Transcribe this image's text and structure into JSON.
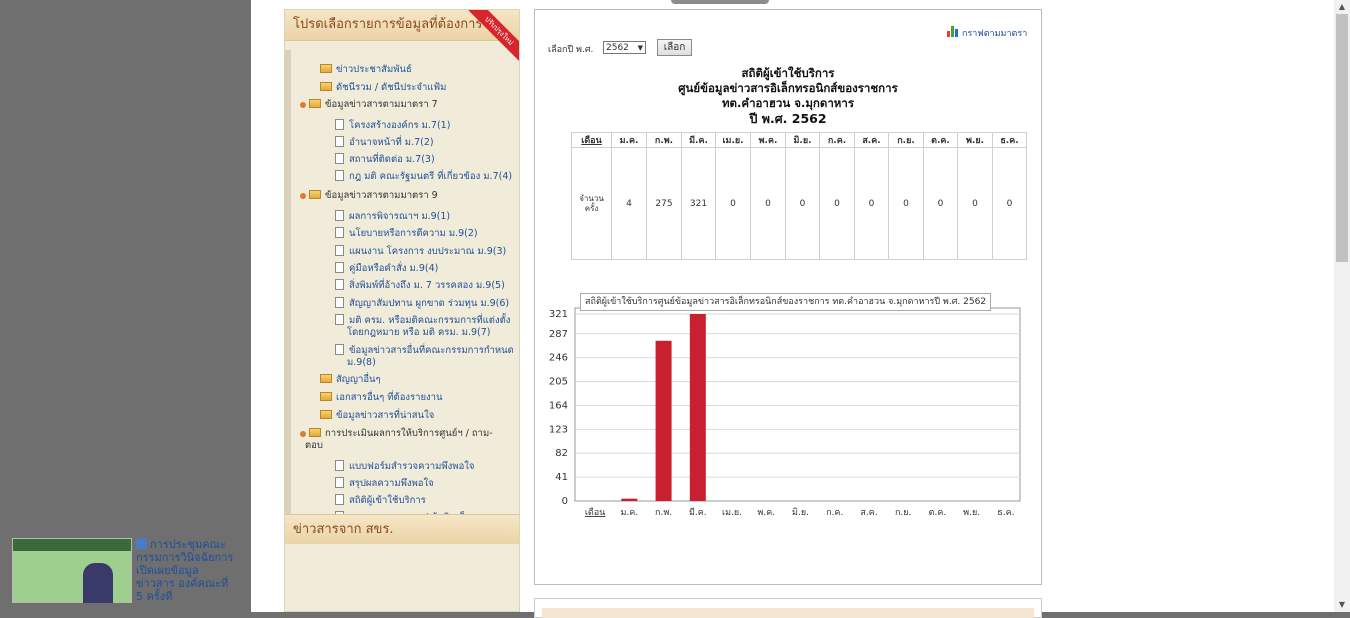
{
  "sidebar": {
    "header": "โปรดเลือกรายการข้อมูลที่ต้องการ",
    "ribbon": "ปรับปรุงใหม่",
    "items": [
      {
        "type": "folder",
        "label": "ข่าวประชาสัมพันธ์"
      },
      {
        "type": "folder",
        "label": "ดัชนีรวม / ดัชนีประจำแฟ้ม"
      },
      {
        "type": "group",
        "label": "ข้อมูลข่าวสารตามมาตรา 7"
      },
      {
        "type": "page",
        "label": "โครงสร้างองค์กร ม.7(1)"
      },
      {
        "type": "page",
        "label": "อำนาจหน้าที่ ม.7(2)"
      },
      {
        "type": "page",
        "label": "สถานที่ติดต่อ ม.7(3)"
      },
      {
        "type": "page",
        "label": "กฎ มติ คณะรัฐมนตรี ที่เกี่ยวข้อง ม.7(4)"
      },
      {
        "type": "group",
        "label": "ข้อมูลข่าวสารตามมาตรา 9"
      },
      {
        "type": "page",
        "label": "ผลการพิจารณาฯ ม.9(1)"
      },
      {
        "type": "page",
        "label": "นโยบายหรือการตีความ ม.9(2)"
      },
      {
        "type": "page",
        "label": "แผนงาน โครงการ งบประมาณ ม.9(3)"
      },
      {
        "type": "page",
        "label": "คู่มือหรือคำสั่ง ม.9(4)"
      },
      {
        "type": "page",
        "label": "สิ่งพิมพ์ที่อ้างถึง ม. 7 วรรคสอง ม.9(5)"
      },
      {
        "type": "page",
        "label": "สัญญาสัมปทาน ผูกขาด ร่วมทุน ม.9(6)"
      },
      {
        "type": "page",
        "label": "มติ ครม. หรือมติคณะกรรมการที่แต่งตั้ง",
        "label2": "โดยกฎหมาย หรือ มติ ครม. ม.9(7)"
      },
      {
        "type": "page",
        "label": "ข้อมูลข่าวสารอื่นที่คณะกรรมการกำหนด",
        "label2": "ม.9(8)"
      },
      {
        "type": "folder",
        "label": "สัญญาอื่นๆ"
      },
      {
        "type": "folder",
        "label": "เอกสารอื่นๆ ที่ต้องรายงาน"
      },
      {
        "type": "folder",
        "label": "ข้อมูลข่าวสารที่น่าสนใจ"
      },
      {
        "type": "group",
        "label": "การประเมินผลการให้บริการศูนย์ฯ / ถาม-",
        "label2": "ตอบ"
      },
      {
        "type": "page",
        "label": "แบบฟอร์มสำรวจความพึงพอใจ"
      },
      {
        "type": "page",
        "label": "สรุปผลความพึงพอใจ"
      },
      {
        "type": "page",
        "label": "สถิติผู้เข้าใช้บริการ"
      },
      {
        "type": "page",
        "label": "กระดานถาม-ตอบ / ข้อคิดเห็น"
      }
    ],
    "news_header": "ข่าวสารจาก สขร.",
    "news_text": "การประชุมคณะกรรมการวินิจฉัยการเปิดเผยข้อมูลข่าวสาร องค์คณะที่ 5 ครั้งที่"
  },
  "main": {
    "graph_link": "กราฟตามมาตรา",
    "year_label": "เลือกปี พ.ศ.",
    "year_value": "2562",
    "select_button": "เลือก",
    "title_line1": "สถิติผู้เข้าใช้บริการ",
    "title_line2": "ศูนย์ข้อมูลข่าวสารอิเล็กทรอนิกส์ของราชการ",
    "title_line3": "ทต.คำอาฮวน จ.มุกดาหาร",
    "title_line4": "ปี พ.ศ. 2562",
    "table": {
      "month_header": "เดือน",
      "months": [
        "ม.ค.",
        "ก.พ.",
        "มี.ค.",
        "เม.ย.",
        "พ.ค.",
        "มิ.ย.",
        "ก.ค.",
        "ส.ค.",
        "ก.ย.",
        "ต.ค.",
        "พ.ย.",
        "ธ.ค."
      ],
      "row_label_1": "จำนวน",
      "row_label_2": "ครั้ง",
      "values": [
        "4",
        "275",
        "321",
        "0",
        "0",
        "0",
        "0",
        "0",
        "0",
        "0",
        "0",
        "0"
      ]
    }
  },
  "chart_data": {
    "type": "bar",
    "title": "สถิติผู้เข้าใช้บริการศูนย์ข้อมูลข่าวสารอิเล็กทรอนิกส์ของราชการ ทต.คำอาฮวน จ.มุกดาหารปี พ.ศ. 2562",
    "x_header": "เดือน",
    "categories": [
      "ม.ค.",
      "ก.พ.",
      "มี.ค.",
      "เม.ย.",
      "พ.ค.",
      "มิ.ย.",
      "ก.ค.",
      "ส.ค.",
      "ก.ย.",
      "ต.ค.",
      "พ.ย.",
      "ธ.ค."
    ],
    "values": [
      4,
      275,
      321,
      0,
      0,
      0,
      0,
      0,
      0,
      0,
      0,
      0
    ],
    "yticks": [
      0,
      41,
      82,
      123,
      164,
      205,
      246,
      287,
      321
    ],
    "ylim": [
      0,
      321
    ],
    "grid": true,
    "bar_color": "#c8202e"
  }
}
